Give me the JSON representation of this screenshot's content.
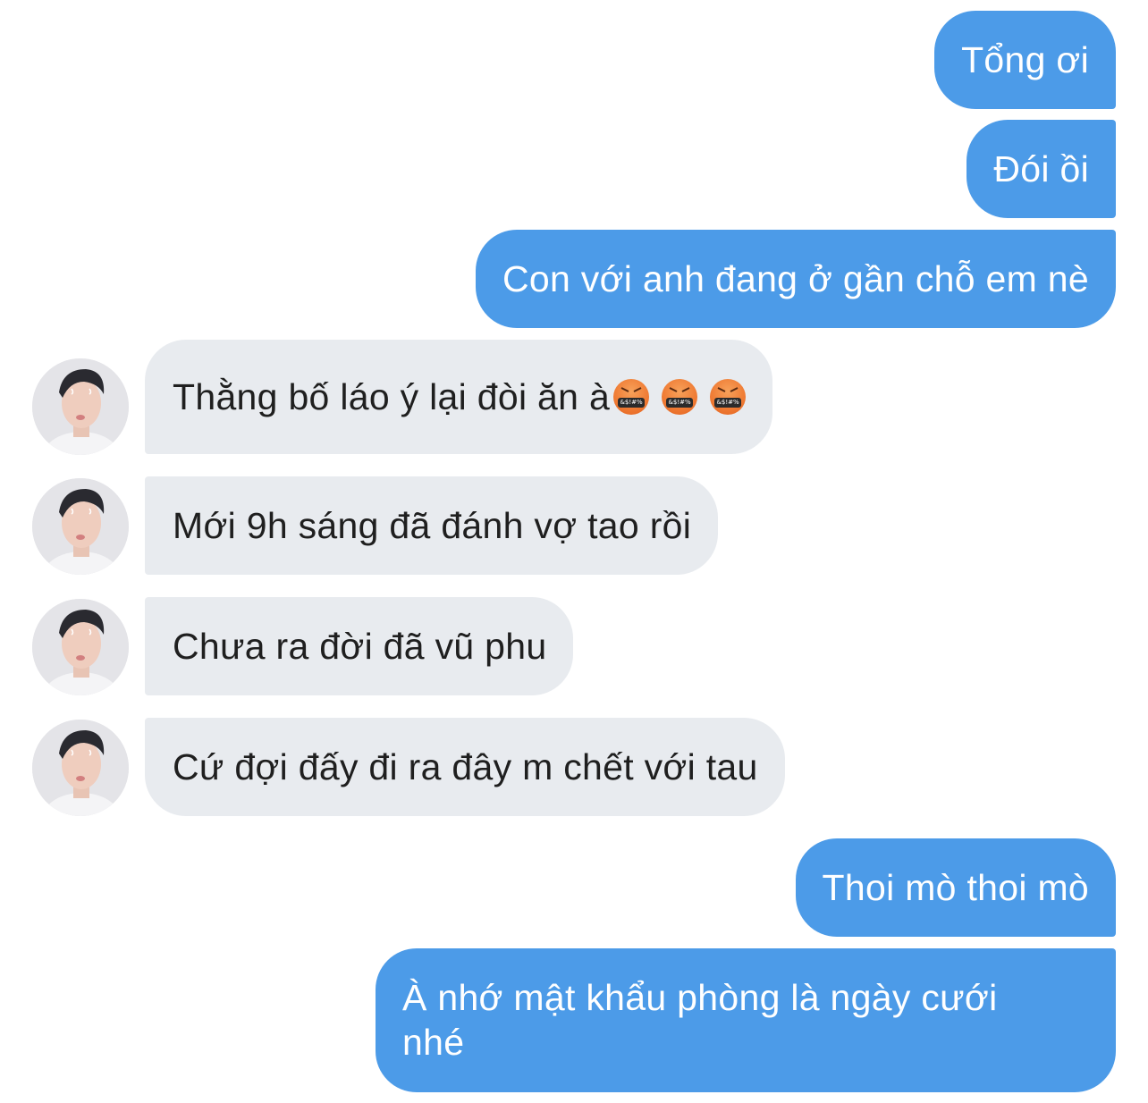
{
  "messages": [
    {
      "side": "out",
      "text": "Tổng ơi"
    },
    {
      "side": "out",
      "text": "Đói ồi"
    },
    {
      "side": "out",
      "text": "Con với anh đang ở gần chỗ em nè"
    },
    {
      "side": "in",
      "text": "Thằng bố láo ý lại đòi ăn à",
      "emojis": [
        "angry-censored-emoji",
        "angry-censored-emoji",
        "angry-censored-emoji"
      ]
    },
    {
      "side": "in",
      "text": "Mới 9h sáng đã đánh vợ tao rồi"
    },
    {
      "side": "in",
      "text": "Chưa ra đời đã vũ phu"
    },
    {
      "side": "in",
      "text": "Cứ đợi đấy đi ra đây m chết với tau"
    },
    {
      "side": "out",
      "text": "Thoi mò thoi mò"
    },
    {
      "side": "out",
      "text_line1": "À nhớ mật khẩu phòng là ngày cưới",
      "text_line2": "nhé"
    }
  ],
  "emoji_mask_text": "&$!#%",
  "colors": {
    "outgoing_bubble": "#4c9be8",
    "incoming_bubble": "#e8ebef",
    "background": "#ffffff"
  }
}
